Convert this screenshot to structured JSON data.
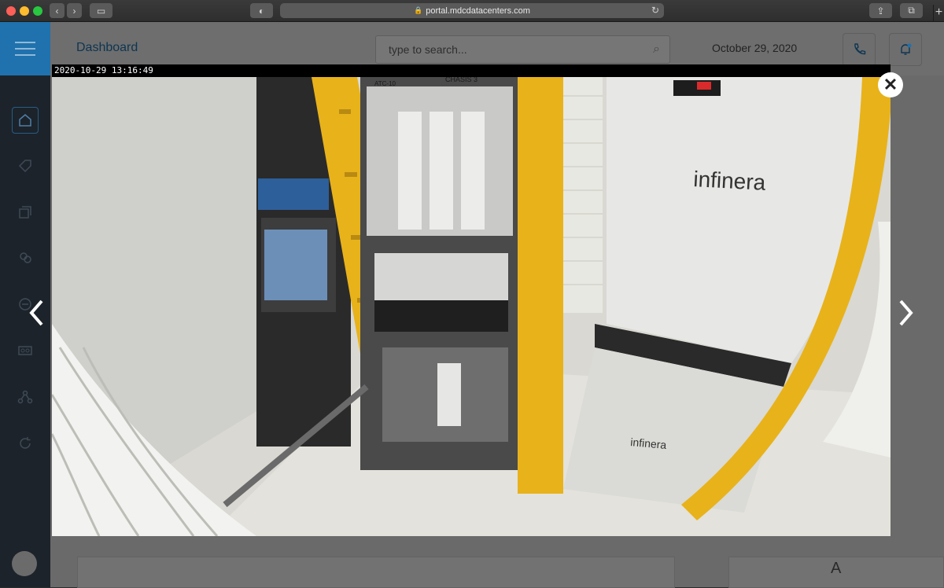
{
  "browser": {
    "url": "portal.mdcdatacenters.com"
  },
  "header": {
    "title": "Dashboard",
    "search_placeholder": "type to search...",
    "date": "October 29, 2020"
  },
  "sidebar": {
    "items": [
      {
        "icon": "home-icon"
      },
      {
        "icon": "tag-icon"
      },
      {
        "icon": "copy-icon"
      },
      {
        "icon": "users-icon"
      },
      {
        "icon": "minus-circle-icon"
      },
      {
        "icon": "tape-icon"
      },
      {
        "icon": "network-icon"
      },
      {
        "icon": "refresh-icon"
      }
    ]
  },
  "background": {
    "letter": "A"
  },
  "viewer": {
    "timestamp": "2020-10-29 13:16:49",
    "labels": {
      "brand": "infinera",
      "chassis": "CHASIS 3",
      "rack": "ATC-10"
    }
  },
  "colors": {
    "accent": "#1f72ad",
    "sidebar": "#1c232b",
    "rack_yellow": "#e8b21a"
  }
}
